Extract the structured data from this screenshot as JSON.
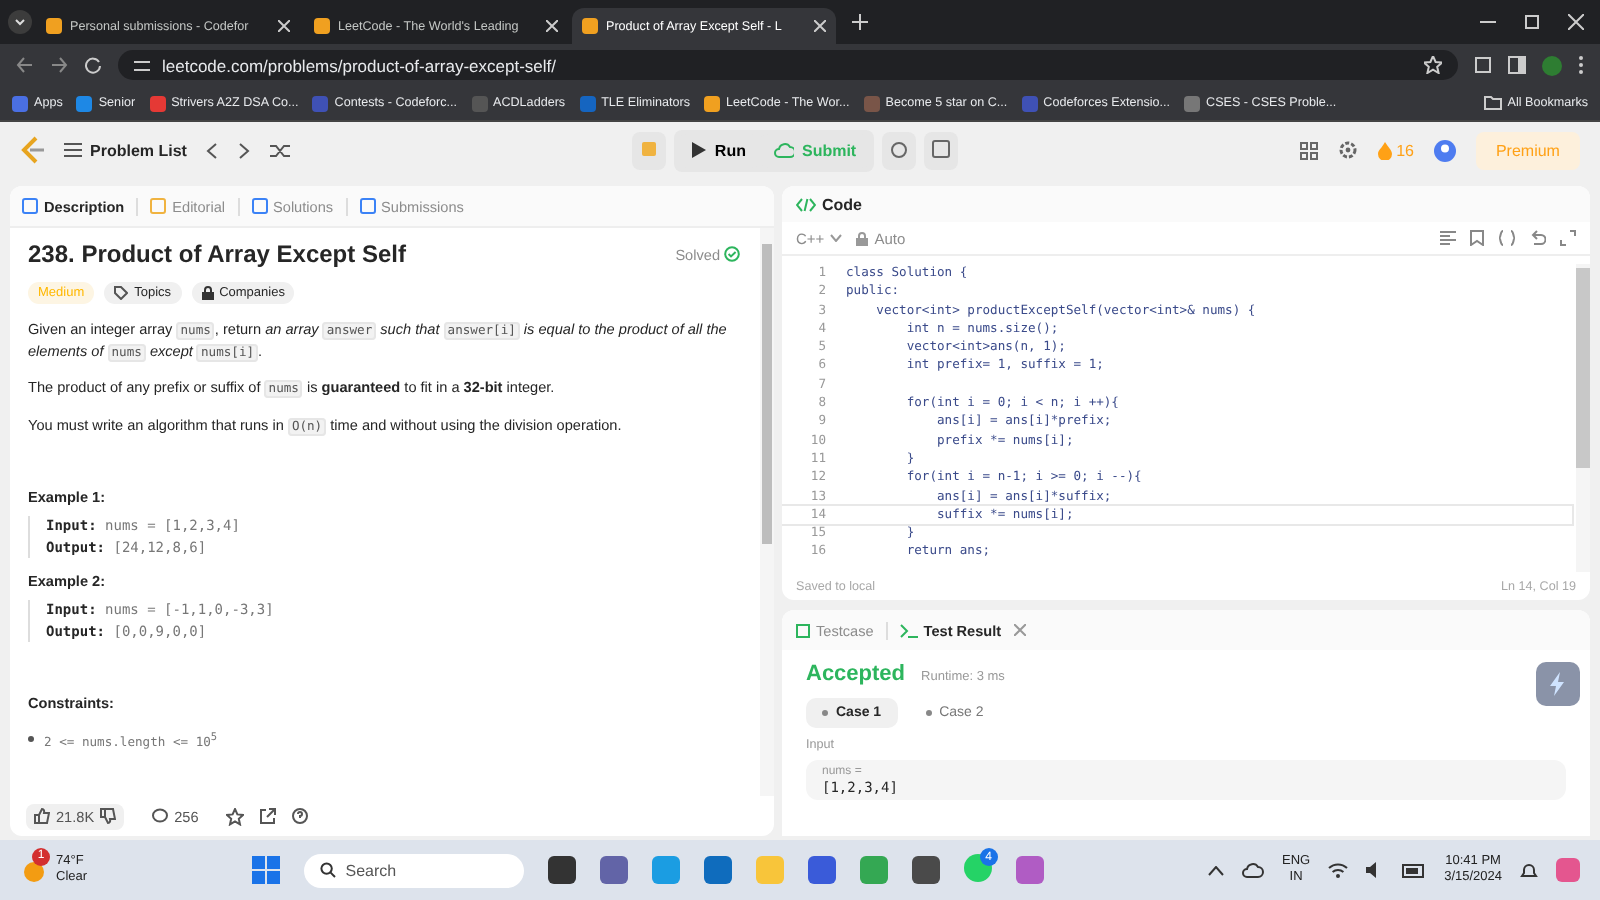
{
  "browser": {
    "tabs": [
      {
        "title": "Personal submissions - Codefor",
        "selected": false
      },
      {
        "title": "LeetCode - The World's Leading",
        "selected": false
      },
      {
        "title": "Product of Array Except Self - L",
        "selected": true
      }
    ],
    "url": "leetcode.com/problems/product-of-array-except-self/",
    "bookmarks": [
      "Apps",
      "Senior",
      "Strivers A2Z DSA Co...",
      "Contests - Codeforc...",
      "ACDLadders",
      "TLE Eliminators",
      "LeetCode - The Wor...",
      "Become 5 star on C...",
      "Codeforces Extensio...",
      "CSES - CSES Proble..."
    ],
    "all_bookmarks": "All Bookmarks"
  },
  "nav": {
    "problem_list": "Problem List",
    "run": "Run",
    "submit": "Submit",
    "streak": "16",
    "premium": "Premium"
  },
  "description": {
    "tabs": [
      {
        "label": "Description",
        "selected": true
      },
      {
        "label": "Editorial",
        "selected": false
      },
      {
        "label": "Solutions",
        "selected": false
      },
      {
        "label": "Submissions",
        "selected": false
      }
    ],
    "title": "238. Product of Array Except Self",
    "status": "Solved",
    "difficulty": "Medium",
    "tags": [
      "Topics",
      "Companies"
    ],
    "paragraphs": [
      [
        {
          "kind": "text",
          "text": "Given an integer array "
        },
        {
          "kind": "code",
          "text": "nums"
        },
        {
          "kind": "text",
          "text": ", return "
        },
        {
          "kind": "italic",
          "text": "an array "
        },
        {
          "kind": "code",
          "text": "answer"
        },
        {
          "kind": "italic",
          "text": " such that "
        },
        {
          "kind": "code",
          "text": "answer[i]"
        },
        {
          "kind": "italic",
          "text": " is equal to the product of all the elements of "
        },
        {
          "kind": "code",
          "text": "nums"
        },
        {
          "kind": "italic",
          "text": " except "
        },
        {
          "kind": "code",
          "text": "nums[i]"
        },
        {
          "kind": "text",
          "text": "."
        }
      ],
      [
        {
          "kind": "text",
          "text": "The product of any prefix or suffix of "
        },
        {
          "kind": "code",
          "text": "nums"
        },
        {
          "kind": "text",
          "text": " is "
        },
        {
          "kind": "bold",
          "text": "guaranteed"
        },
        {
          "kind": "text",
          "text": " to fit in a "
        },
        {
          "kind": "bold",
          "text": "32-bit"
        },
        {
          "kind": "text",
          "text": " integer."
        }
      ],
      [
        {
          "kind": "text",
          "text": "You must write an algorithm that runs in "
        },
        {
          "kind": "code",
          "text": "O(n)"
        },
        {
          "kind": "text",
          "text": " time and without using the division operation."
        }
      ]
    ],
    "examples": [
      {
        "title": "Example 1:",
        "input_label": "Input:",
        "input": "nums = [1,2,3,4]",
        "output_label": "Output:",
        "output": "[24,12,8,6]"
      },
      {
        "title": "Example 2:",
        "input_label": "Input:",
        "input": "nums = [-1,1,0,-3,3]",
        "output_label": "Output:",
        "output": "[0,0,9,0,0]"
      }
    ],
    "constraints_title": "Constraints:",
    "constraints": [
      "2 <= nums.length <= 10$^{5}$"
    ],
    "likes": "21.8K",
    "comments": "256"
  },
  "code": {
    "title": "Code",
    "language": "C++",
    "mode": "Auto",
    "lines": [
      {
        "no": "1",
        "text": "class Solution {",
        "current": false
      },
      {
        "no": "2",
        "text": "public:",
        "current": false
      },
      {
        "no": "3",
        "text": "    vector<int> productExceptSelf(vector<int>& nums) {",
        "current": false
      },
      {
        "no": "4",
        "text": "        int n = nums.size();",
        "current": false
      },
      {
        "no": "5",
        "text": "        vector<int>ans(n, 1);",
        "current": false
      },
      {
        "no": "6",
        "text": "        int prefix= 1, suffix = 1;",
        "current": false
      },
      {
        "no": "7",
        "current": false
      },
      {
        "no": "8",
        "text": "        for(int i = 0; i < n; i ++){",
        "current": false
      },
      {
        "no": "9",
        "text": "            ans[i] = ans[i]*prefix;",
        "current": false
      },
      {
        "no": "10",
        "text": "            prefix *= nums[i];",
        "current": false
      },
      {
        "no": "11",
        "text": "        }",
        "current": false
      },
      {
        "no": "12",
        "text": "        for(int i = n-1; i >= 0; i --){",
        "current": false
      },
      {
        "no": "13",
        "text": "            ans[i] = ans[i]*suffix;",
        "current": false
      },
      {
        "no": "14",
        "text": "            suffix *= nums[i];",
        "current": true
      },
      {
        "no": "15",
        "text": "        }",
        "current": false
      },
      {
        "no": "16",
        "text": "        return ans;",
        "current": false
      }
    ],
    "saved": "Saved to local",
    "cursor": "Ln 14, Col 19"
  },
  "result": {
    "tabs": [
      {
        "label": "Testcase",
        "selected": false
      },
      {
        "label": "Test Result",
        "selected": true
      }
    ],
    "verdict": "Accepted",
    "runtime": "Runtime: 3 ms",
    "cases": [
      {
        "label": "Case 1",
        "selected": true
      },
      {
        "label": "Case 2",
        "selected": false
      }
    ],
    "input_label": "Input",
    "variable": "nums =",
    "value": "[1,2,3,4]"
  },
  "taskbar": {
    "temperature": "74°F",
    "weather": "Clear",
    "weather_badge": "1",
    "search_placeholder": "Search",
    "chat_badge": "4",
    "language": "ENG",
    "region": "IN",
    "time": "10:41 PM",
    "date": "3/15/2024"
  }
}
